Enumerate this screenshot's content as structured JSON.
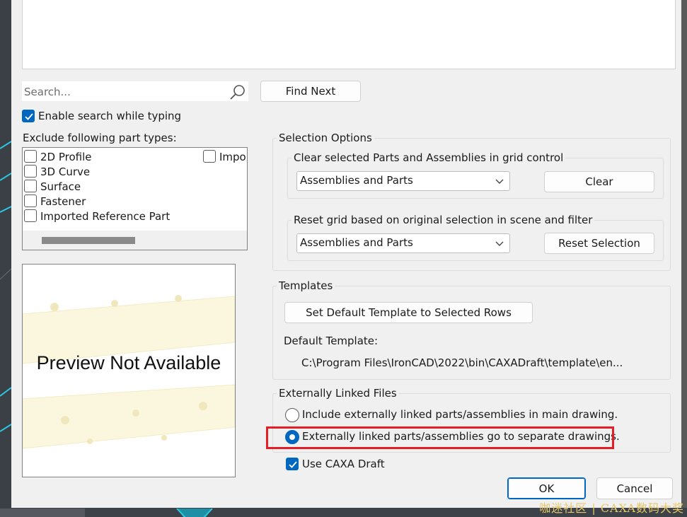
{
  "search": {
    "placeholder": "Search..."
  },
  "find_next_label": "Find Next",
  "enable_search_label": "Enable search while typing",
  "exclude": {
    "title": "Exclude following part types:",
    "items": [
      "2D Profile",
      "3D Curve",
      "Surface",
      "Fastener",
      "Imported Reference Part"
    ],
    "partial_item": "Impo"
  },
  "preview_text": "Preview Not Available",
  "selection_options": {
    "title": "Selection Options",
    "clear_group": {
      "title": "Clear selected Parts and Assemblies in grid control",
      "value": "Assemblies and Parts",
      "button": "Clear"
    },
    "reset_group": {
      "title": "Reset grid based on original selection in scene and filter",
      "value": "Assemblies and Parts",
      "button": "Reset Selection"
    }
  },
  "templates": {
    "title": "Templates",
    "button": "Set Default Template to Selected Rows",
    "default_label": "Default Template:",
    "default_path": "C:\\Program Files\\IronCAD\\2022\\bin\\CAXADraft\\template\\en..."
  },
  "linked_files": {
    "title": "Externally Linked Files",
    "option1": "Include externally linked parts/assemblies in main drawing.",
    "option2": "Externally linked parts/assemblies go to separate drawings."
  },
  "use_caxa_label": "Use CAXA Draft",
  "ok_label": "OK",
  "cancel_label": "Cancel",
  "watermark": "咖迷社区 | CAXA数码大奖",
  "colors": {
    "accent": "#0067c0",
    "highlight": "#e41e26",
    "watermark": "#e8c86a"
  }
}
